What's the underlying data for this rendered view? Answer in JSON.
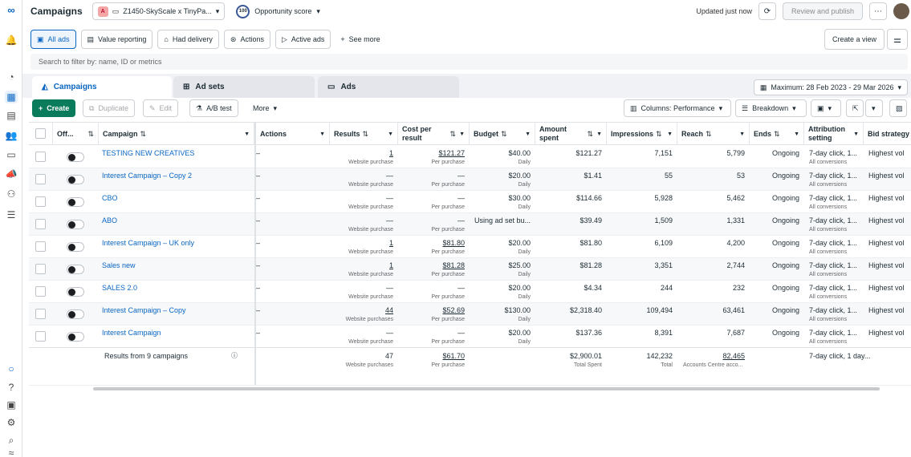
{
  "topbar": {
    "title": "Campaigns",
    "account_initial": "A",
    "account_name": "Z1450-SkyScale x TinyPa...",
    "opportunity_score": "100",
    "opportunity_label": "Opportunity score",
    "updated": "Updated just now",
    "review_publish": "Review and publish",
    "more": "⋯"
  },
  "filters": {
    "items": [
      "All ads",
      "Value reporting",
      "Had delivery",
      "Actions",
      "Active ads"
    ],
    "see_more": "See more",
    "create_view": "Create a view"
  },
  "search": {
    "placeholder": "Search to filter by: name, ID or metrics"
  },
  "tabs": {
    "campaigns": "Campaigns",
    "adsets": "Ad sets",
    "ads": "Ads",
    "date_range": "Maximum: 28 Feb 2023 - 29 Mar 2026"
  },
  "toolbar": {
    "create": "Create",
    "duplicate": "Duplicate",
    "edit": "Edit",
    "ab_test": "A/B test",
    "more": "More",
    "columns": "Columns: Performance",
    "breakdown": "Breakdown"
  },
  "columns": {
    "off": "Off...",
    "campaign": "Campaign",
    "actions": "Actions",
    "results": "Results",
    "cost_per_result": "Cost per result",
    "budget": "Budget",
    "amount_spent": "Amount spent",
    "impressions": "Impressions",
    "reach": "Reach",
    "ends": "Ends",
    "attribution": "Attribution setting",
    "bid": "Bid strategy"
  },
  "rows": [
    {
      "name": "TESTING NEW CREATIVES",
      "results": "1",
      "results_sub": "Website purchase",
      "cpr": "$121.27",
      "cpr_sub": "Per purchase",
      "budget": "$40.00",
      "budget_sub": "Daily",
      "spent": "$121.27",
      "impr": "7,151",
      "reach": "5,799",
      "ends": "Ongoing",
      "attr": "7-day click, 1...",
      "attr_sub": "All conversions",
      "bid": "Highest vol"
    },
    {
      "name": "Interest Campaign – Copy 2",
      "results": "—",
      "results_sub": "Website purchase",
      "cpr": "—",
      "cpr_sub": "Per purchase",
      "budget": "$20.00",
      "budget_sub": "Daily",
      "spent": "$1.41",
      "impr": "55",
      "reach": "53",
      "ends": "Ongoing",
      "attr": "7-day click, 1...",
      "attr_sub": "All conversions",
      "bid": "Highest vol"
    },
    {
      "name": "CBO",
      "results": "—",
      "results_sub": "Website purchase",
      "cpr": "—",
      "cpr_sub": "Per purchase",
      "budget": "$30.00",
      "budget_sub": "Daily",
      "spent": "$114.66",
      "impr": "5,928",
      "reach": "5,462",
      "ends": "Ongoing",
      "attr": "7-day click, 1...",
      "attr_sub": "All conversions",
      "bid": "Highest vol"
    },
    {
      "name": "ABO",
      "results": "—",
      "results_sub": "Website purchase",
      "cpr": "—",
      "cpr_sub": "Per purchase",
      "budget": "Using ad set bu...",
      "budget_sub": "",
      "spent": "$39.49",
      "impr": "1,509",
      "reach": "1,331",
      "ends": "Ongoing",
      "attr": "7-day click, 1...",
      "attr_sub": "All conversions",
      "bid": "Highest vol"
    },
    {
      "name": "Interest Campaign – UK only",
      "results": "1",
      "results_sub": "Website purchase",
      "cpr": "$81.80",
      "cpr_sub": "Per purchase",
      "budget": "$20.00",
      "budget_sub": "Daily",
      "spent": "$81.80",
      "impr": "6,109",
      "reach": "4,200",
      "ends": "Ongoing",
      "attr": "7-day click, 1...",
      "attr_sub": "All conversions",
      "bid": "Highest vol"
    },
    {
      "name": "Sales new",
      "results": "1",
      "results_sub": "Website purchase",
      "cpr": "$81.28",
      "cpr_sub": "Per purchase",
      "budget": "$25.00",
      "budget_sub": "Daily",
      "spent": "$81.28",
      "impr": "3,351",
      "reach": "2,744",
      "ends": "Ongoing",
      "attr": "7-day click, 1...",
      "attr_sub": "All conversions",
      "bid": "Highest vol"
    },
    {
      "name": "SALES 2.0",
      "results": "—",
      "results_sub": "Website purchase",
      "cpr": "—",
      "cpr_sub": "Per purchase",
      "budget": "$20.00",
      "budget_sub": "Daily",
      "spent": "$4.34",
      "impr": "244",
      "reach": "232",
      "ends": "Ongoing",
      "attr": "7-day click, 1...",
      "attr_sub": "All conversions",
      "bid": "Highest vol"
    },
    {
      "name": "Interest Campaign – Copy",
      "results": "44",
      "results_sub": "Website purchases",
      "cpr": "$52.69",
      "cpr_sub": "Per purchase",
      "budget": "$130.00",
      "budget_sub": "Daily",
      "spent": "$2,318.40",
      "impr": "109,494",
      "reach": "63,461",
      "ends": "Ongoing",
      "attr": "7-day click, 1...",
      "attr_sub": "All conversions",
      "bid": "Highest vol"
    },
    {
      "name": "Interest Campaign",
      "results": "—",
      "results_sub": "Website purchase",
      "cpr": "—",
      "cpr_sub": "Per purchase",
      "budget": "$20.00",
      "budget_sub": "Daily",
      "spent": "$137.36",
      "impr": "8,391",
      "reach": "7,687",
      "ends": "Ongoing",
      "attr": "7-day click, 1...",
      "attr_sub": "All conversions",
      "bid": "Highest vol"
    }
  ],
  "summary": {
    "label": "Results from 9 campaigns",
    "results": "47",
    "results_sub": "Website purchases",
    "cpr": "$61.70",
    "cpr_sub": "Per purchase",
    "spent": "$2,900.01",
    "spent_sub": "Total Spent",
    "impr": "142,232",
    "impr_sub": "Total",
    "reach": "82,465",
    "reach_sub": "Accounts Centre acco...",
    "attr": "7-day click, 1 day..."
  },
  "colors": {
    "accent": "#0a66c2",
    "create_green": "#0a7b5b"
  }
}
